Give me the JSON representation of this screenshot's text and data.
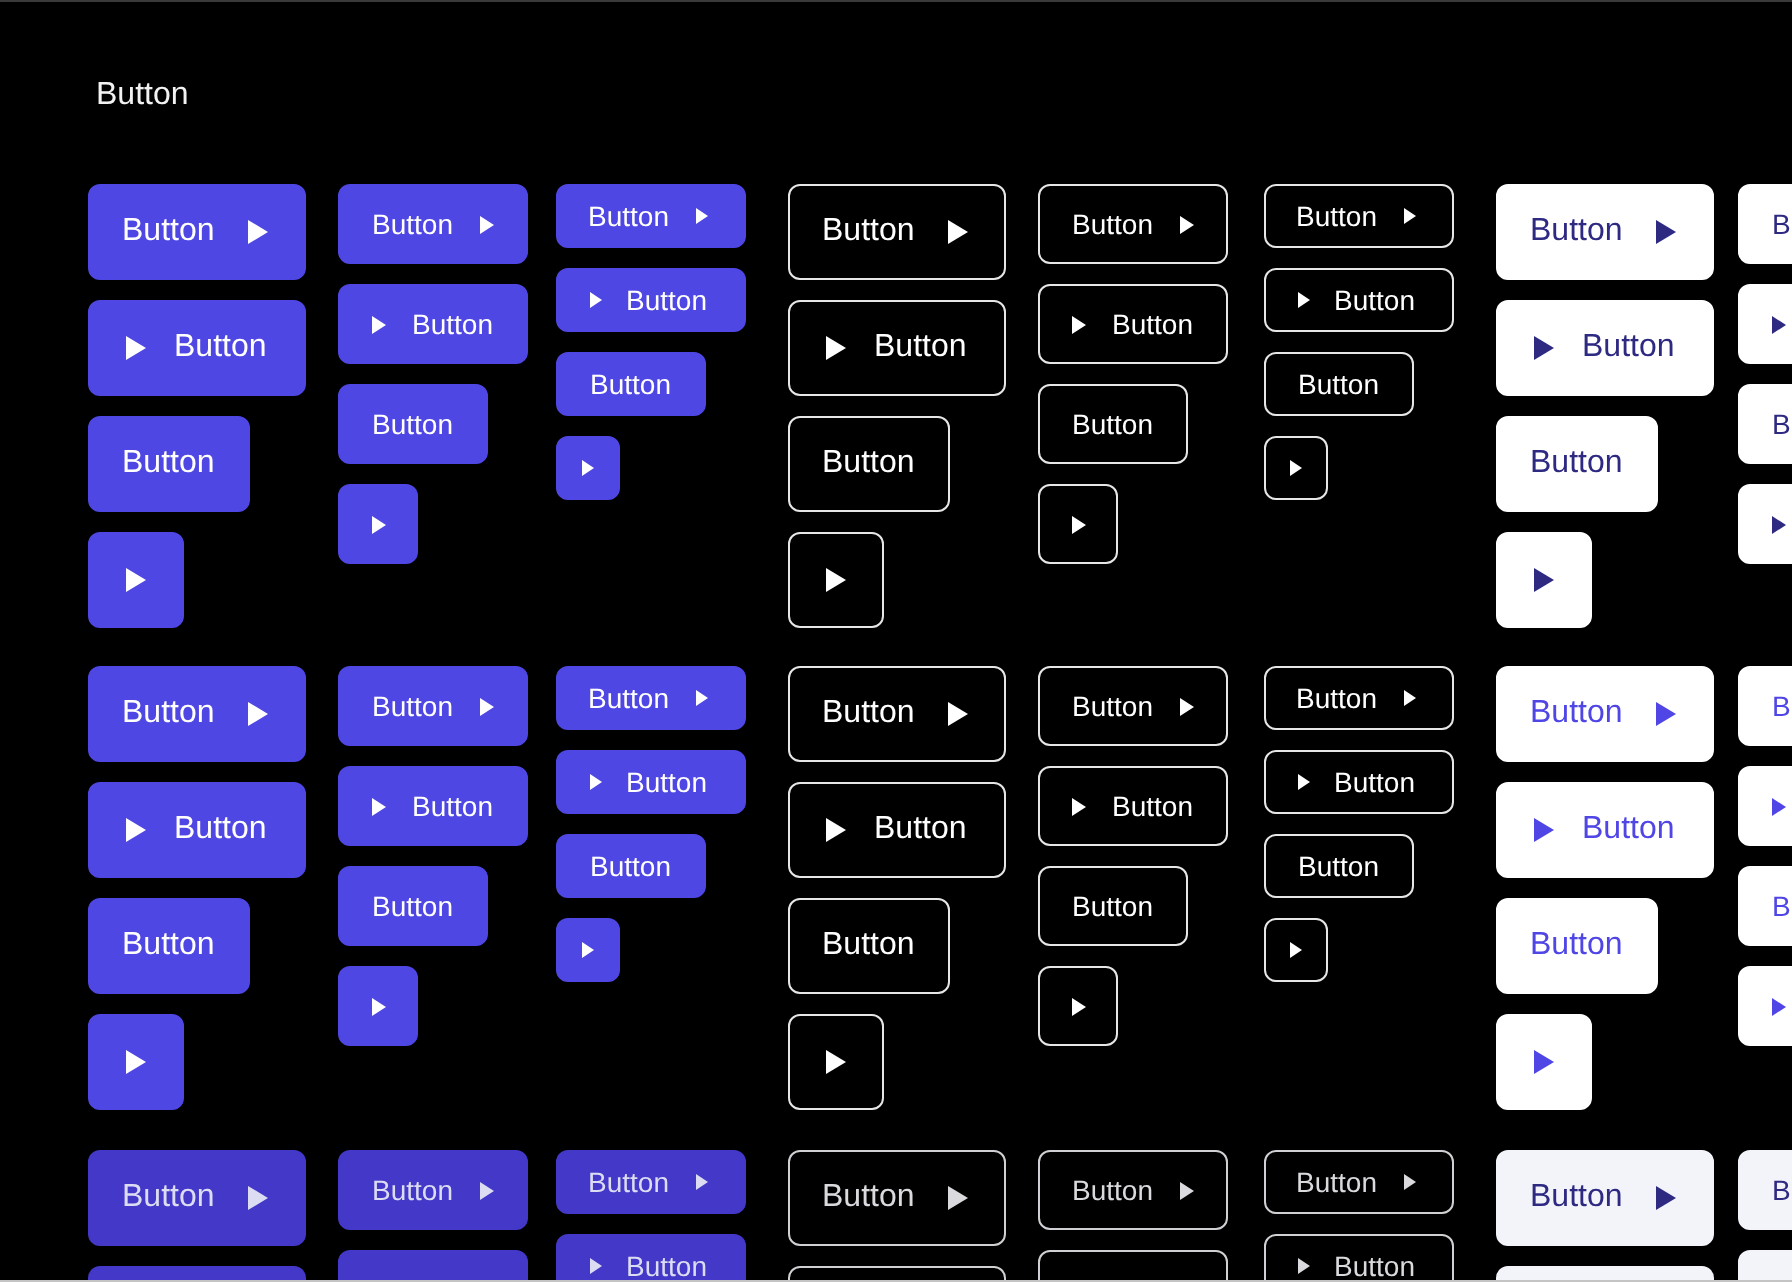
{
  "title": "Button",
  "rows": [
    {
      "groups": [
        {
          "columns": [
            {
              "buttons": [
                {
                  "kind": "text-icon",
                  "label": "Button"
                },
                {
                  "kind": "icon-text",
                  "label": "Button"
                },
                {
                  "kind": "text",
                  "label": "Button"
                },
                {
                  "kind": "icon"
                }
              ]
            },
            {
              "buttons": [
                {
                  "kind": "text-icon",
                  "label": "Button"
                },
                {
                  "kind": "icon-text",
                  "label": "Button"
                },
                {
                  "kind": "text",
                  "label": "Button"
                },
                {
                  "kind": "icon"
                }
              ]
            },
            {
              "buttons": [
                {
                  "kind": "text-icon",
                  "label": "Button"
                },
                {
                  "kind": "icon-text",
                  "label": "Button"
                },
                {
                  "kind": "text",
                  "label": "Button"
                },
                {
                  "kind": "icon"
                }
              ]
            }
          ]
        },
        {
          "columns": [
            {
              "buttons": [
                {
                  "kind": "text-icon",
                  "label": "Button"
                },
                {
                  "kind": "icon-text",
                  "label": "Button"
                },
                {
                  "kind": "text",
                  "label": "Button"
                },
                {
                  "kind": "icon"
                }
              ]
            },
            {
              "buttons": [
                {
                  "kind": "text-icon",
                  "label": "Button"
                },
                {
                  "kind": "icon-text",
                  "label": "Button"
                },
                {
                  "kind": "text",
                  "label": "Button"
                },
                {
                  "kind": "icon"
                }
              ]
            },
            {
              "buttons": [
                {
                  "kind": "text-icon",
                  "label": "Button"
                },
                {
                  "kind": "icon-text",
                  "label": "Button"
                },
                {
                  "kind": "text",
                  "label": "Button"
                },
                {
                  "kind": "icon"
                }
              ]
            }
          ]
        },
        {
          "columns": [
            {
              "buttons": [
                {
                  "kind": "text-icon",
                  "label": "Button"
                },
                {
                  "kind": "icon-text",
                  "label": "Button"
                },
                {
                  "kind": "text",
                  "label": "Button"
                },
                {
                  "kind": "icon"
                }
              ]
            },
            {
              "buttons": [
                {
                  "kind": "text-icon",
                  "label": "B"
                },
                {
                  "kind": "icon-text"
                },
                {
                  "kind": "text",
                  "label": "B"
                },
                {
                  "kind": "icon"
                }
              ]
            }
          ]
        }
      ]
    },
    {
      "groups": [
        {
          "columns": [
            {
              "buttons": [
                {
                  "kind": "text-icon",
                  "label": "Button"
                },
                {
                  "kind": "icon-text",
                  "label": "Button"
                },
                {
                  "kind": "text",
                  "label": "Button"
                },
                {
                  "kind": "icon"
                }
              ]
            },
            {
              "buttons": [
                {
                  "kind": "text-icon",
                  "label": "Button"
                },
                {
                  "kind": "icon-text",
                  "label": "Button"
                },
                {
                  "kind": "text",
                  "label": "Button"
                },
                {
                  "kind": "icon"
                }
              ]
            },
            {
              "buttons": [
                {
                  "kind": "text-icon",
                  "label": "Button"
                },
                {
                  "kind": "icon-text",
                  "label": "Button"
                },
                {
                  "kind": "text",
                  "label": "Button"
                },
                {
                  "kind": "icon"
                }
              ]
            }
          ]
        },
        {
          "columns": [
            {
              "buttons": [
                {
                  "kind": "text-icon",
                  "label": "Button"
                },
                {
                  "kind": "icon-text",
                  "label": "Button"
                },
                {
                  "kind": "text",
                  "label": "Button"
                },
                {
                  "kind": "icon"
                }
              ]
            },
            {
              "buttons": [
                {
                  "kind": "text-icon",
                  "label": "Button"
                },
                {
                  "kind": "icon-text",
                  "label": "Button"
                },
                {
                  "kind": "text",
                  "label": "Button"
                },
                {
                  "kind": "icon"
                }
              ]
            },
            {
              "buttons": [
                {
                  "kind": "text-icon",
                  "label": "Button"
                },
                {
                  "kind": "icon-text",
                  "label": "Button"
                },
                {
                  "kind": "text",
                  "label": "Button"
                },
                {
                  "kind": "icon"
                }
              ]
            }
          ]
        },
        {
          "columns": [
            {
              "buttons": [
                {
                  "kind": "text-icon",
                  "label": "Button"
                },
                {
                  "kind": "icon-text",
                  "label": "Button"
                },
                {
                  "kind": "text",
                  "label": "Button"
                },
                {
                  "kind": "icon"
                }
              ]
            },
            {
              "buttons": [
                {
                  "kind": "text-icon",
                  "label": "B"
                },
                {
                  "kind": "icon-text"
                },
                {
                  "kind": "text",
                  "label": "B"
                },
                {
                  "kind": "icon"
                }
              ]
            }
          ]
        }
      ]
    },
    {
      "groups": [
        {
          "columns": [
            {
              "buttons": [
                {
                  "kind": "text-icon",
                  "label": "Button"
                },
                {
                  "kind": "edge"
                }
              ]
            },
            {
              "buttons": [
                {
                  "kind": "text-icon",
                  "label": "Button"
                },
                {
                  "kind": "edge"
                }
              ]
            },
            {
              "buttons": [
                {
                  "kind": "text-icon",
                  "label": "Button"
                },
                {
                  "kind": "icon-text",
                  "label": "Button"
                }
              ]
            }
          ]
        },
        {
          "columns": [
            {
              "buttons": [
                {
                  "kind": "text-icon",
                  "label": "Button"
                },
                {
                  "kind": "edge"
                }
              ]
            },
            {
              "buttons": [
                {
                  "kind": "text-icon",
                  "label": "Button"
                },
                {
                  "kind": "edge"
                }
              ]
            },
            {
              "buttons": [
                {
                  "kind": "text-icon",
                  "label": "Button"
                },
                {
                  "kind": "icon-text",
                  "label": "Button"
                }
              ]
            }
          ]
        },
        {
          "columns": [
            {
              "buttons": [
                {
                  "kind": "text-icon",
                  "label": "Button"
                },
                {
                  "kind": "edge"
                }
              ]
            },
            {
              "buttons": [
                {
                  "kind": "text-icon",
                  "label": "B"
                },
                {
                  "kind": "edge"
                }
              ]
            }
          ]
        }
      ]
    }
  ]
}
